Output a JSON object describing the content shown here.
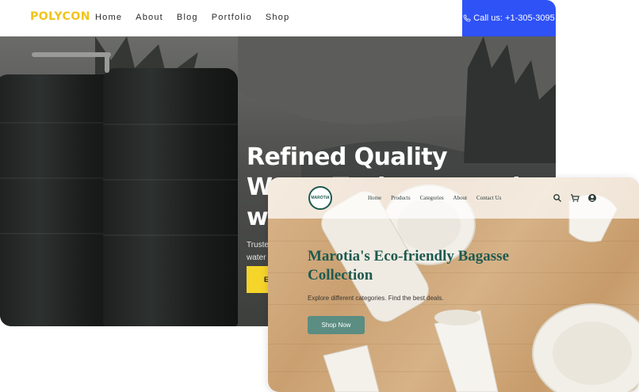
{
  "polycon": {
    "logo": "POLYCON",
    "nav": [
      "Home",
      "About",
      "Blog",
      "Portfolio",
      "Shop"
    ],
    "call_label": "Call us: +1-305-3095",
    "hero_title": "Refined Quality Water Tanks Ensured with Pol",
    "hero_sub_line1": "Truste",
    "hero_sub_line2": "water t",
    "button_label": "E"
  },
  "marotia": {
    "logo_text": "MAROTIA",
    "nav": [
      "Home",
      "Products",
      "Categories",
      "About",
      "Contact Us"
    ],
    "icons": [
      "search-icon",
      "cart-icon",
      "account-icon"
    ],
    "hero_title": "Marotia's Eco-friendly Bagasse Collection",
    "hero_sub": "Explore different categories. Find the best deals.",
    "button_label": "Shop Now",
    "colors": {
      "accent": "#1f5a50",
      "button": "#5b8d82"
    }
  },
  "colors": {
    "polycon_call_bg": "#2f52f6",
    "polycon_logo": "#f0c41b",
    "polycon_button": "#f6d52a"
  }
}
